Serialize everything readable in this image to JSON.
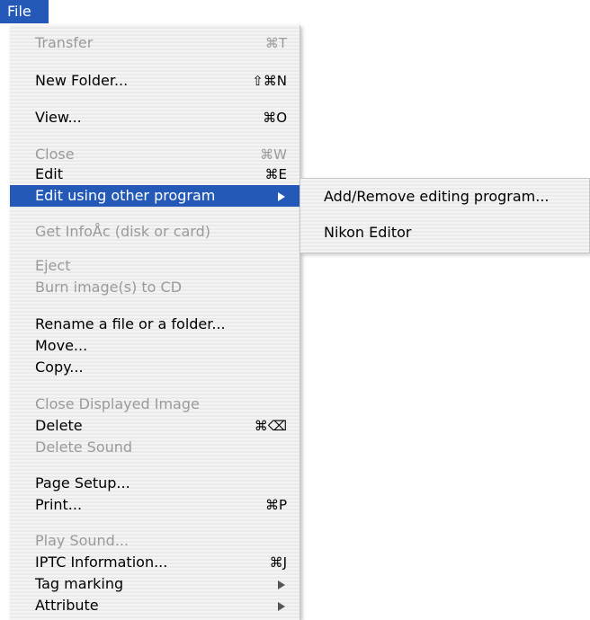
{
  "menubar": {
    "file_label": "File"
  },
  "menu": {
    "items": [
      {
        "label": "Transfer",
        "shortcut": "⌘T",
        "disabled": true
      },
      {
        "label": "New Folder...",
        "shortcut": "⇧⌘N",
        "disabled": false
      },
      {
        "label": "View...",
        "shortcut": "⌘O",
        "disabled": false
      },
      {
        "label": "Close",
        "shortcut": "⌘W",
        "disabled": true
      },
      {
        "label": "Edit",
        "shortcut": "⌘E",
        "disabled": false
      },
      {
        "label": "Edit using other program",
        "submenu": true,
        "selected": true
      },
      {
        "label": "Get InfoÅc (disk or card)",
        "disabled": true
      },
      {
        "label": "Eject",
        "disabled": true
      },
      {
        "label": "Burn image(s) to CD",
        "disabled": true
      },
      {
        "label": "Rename a file or a folder...",
        "disabled": false
      },
      {
        "label": "Move...",
        "disabled": false
      },
      {
        "label": "Copy...",
        "disabled": false
      },
      {
        "label": "Close Displayed Image",
        "disabled": true
      },
      {
        "label": "Delete",
        "shortcut": "⌘⌫",
        "disabled": false
      },
      {
        "label": "Delete Sound",
        "disabled": true
      },
      {
        "label": "Page Setup...",
        "disabled": false
      },
      {
        "label": "Print...",
        "shortcut": "⌘P",
        "disabled": false
      },
      {
        "label": "Play Sound...",
        "disabled": true
      },
      {
        "label": "IPTC Information...",
        "shortcut": "⌘J",
        "disabled": false
      },
      {
        "label": "Tag marking",
        "submenu": true,
        "disabled": false
      },
      {
        "label": "Attribute",
        "submenu": true,
        "disabled": false
      }
    ]
  },
  "submenu": {
    "items": [
      {
        "label": "Add/Remove editing program..."
      },
      {
        "label": "Nikon Editor"
      }
    ]
  }
}
